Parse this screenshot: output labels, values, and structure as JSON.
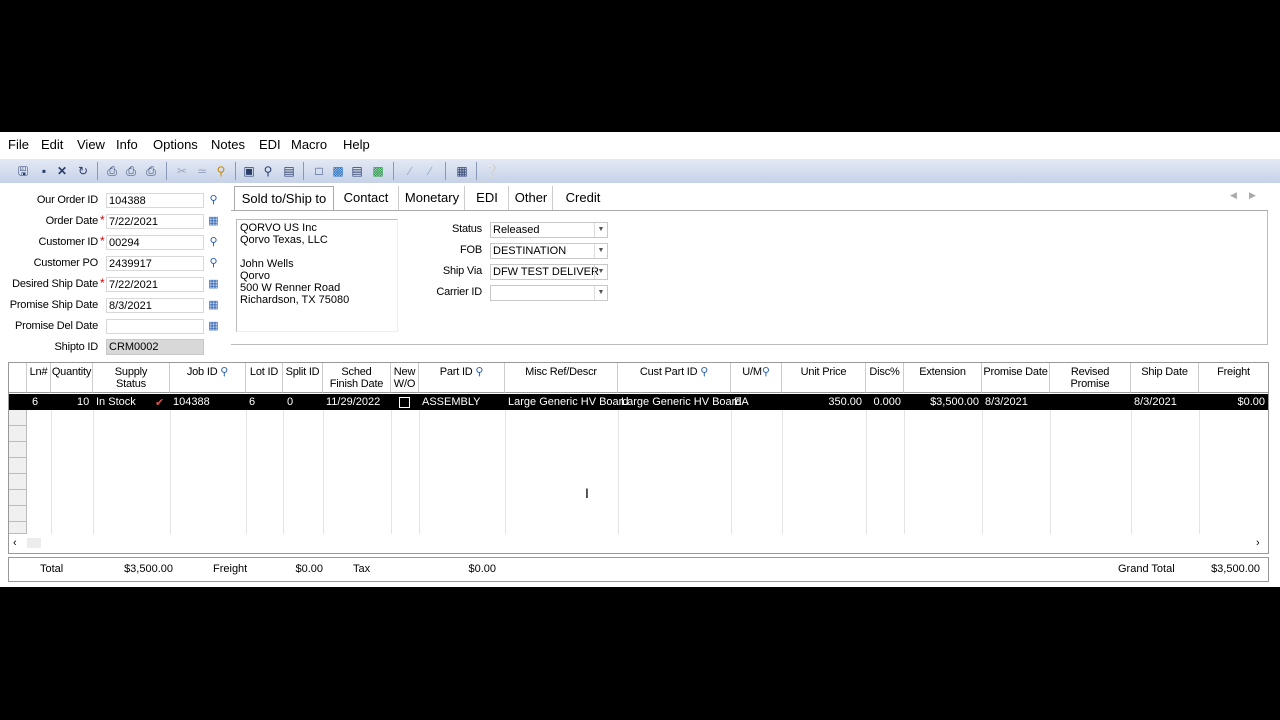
{
  "menu": [
    "File",
    "Edit",
    "View",
    "Info",
    "Options",
    "Notes",
    "EDI",
    "Macro",
    "Help"
  ],
  "toolbar_icons": [
    "save-icon",
    "new-icon",
    "delete-icon",
    "refresh-icon",
    "print-preview-icon",
    "print-icon",
    "print-setup-icon",
    "cut-icon",
    "copy-icon",
    "find-icon",
    "binoculars-icon",
    "attach-icon",
    "document-icon",
    "copy-doc-icon",
    "notes-icon",
    "edi-icon",
    "line-icon",
    "pen-icon",
    "layout-icon",
    "help-icon"
  ],
  "form": {
    "order_id": {
      "label": "Our Order ID",
      "value": "104388"
    },
    "order_date": {
      "label": "Order Date",
      "value": "7/22/2021"
    },
    "customer_id": {
      "label": "Customer ID",
      "value": "00294"
    },
    "customer_po": {
      "label": "Customer PO",
      "value": "2439917"
    },
    "desired_ship": {
      "label": "Desired Ship Date",
      "value": "7/22/2021"
    },
    "promise_ship": {
      "label": "Promise Ship Date",
      "value": "8/3/2021"
    },
    "promise_del": {
      "label": "Promise Del Date",
      "value": ""
    },
    "shipto_id": {
      "label": "Shipto ID",
      "value": "CRM0002"
    }
  },
  "tabs": [
    "Sold to/Ship to",
    "Contact",
    "Monetary",
    "EDI",
    "Other",
    "Credit"
  ],
  "address": {
    "line1": "QORVO US Inc",
    "line2": "Qorvo Texas, LLC",
    "line3": "John Wells",
    "line4": "Qorvo",
    "line5": "500 W Renner Road",
    "line6": "Richardson, TX 75080"
  },
  "status": {
    "label": "Status",
    "value": "Released"
  },
  "fob": {
    "label": "FOB",
    "value": "DESTINATION"
  },
  "ship_via": {
    "label": "Ship Via",
    "value": "DFW TEST DELIVER"
  },
  "carrier": {
    "label": "Carrier ID",
    "value": ""
  },
  "columns": {
    "ln": "Ln#",
    "qty": "Quantity",
    "supply1": "Supply",
    "supply2": "Status",
    "job": "Job ID",
    "lot": "Lot ID",
    "split": "Split ID",
    "sched1": "Sched",
    "sched2": "Finish Date",
    "new1": "New",
    "new2": "W/O",
    "part": "Part ID",
    "misc": "Misc Ref/Descr",
    "cust": "Cust Part ID",
    "um": "U/M",
    "price": "Unit Price",
    "disc": "Disc%",
    "ext": "Extension",
    "promise": "Promise Date",
    "revised": "Revised Promise",
    "ship": "Ship Date",
    "freight": "Freight"
  },
  "row": {
    "ln": "6",
    "qty": "10",
    "supply": "In Stock",
    "job": "104388",
    "lot": "6",
    "split": "0",
    "sched": "11/29/2022",
    "part": "ASSEMBLY",
    "misc": "Large Generic HV Board",
    "cust": "Large Generic HV Board",
    "um": "EA",
    "price": "350.00",
    "disc": "0.000",
    "ext": "$3,500.00",
    "promise": "8/3/2021",
    "revised": "",
    "ship": "8/3/2021",
    "freight": "$0.00"
  },
  "totals": {
    "total_label": "Total",
    "total": "$3,500.00",
    "freight_label": "Freight",
    "freight": "$0.00",
    "tax_label": "Tax",
    "tax": "$0.00",
    "grand_label": "Grand Total",
    "grand": "$3,500.00"
  }
}
